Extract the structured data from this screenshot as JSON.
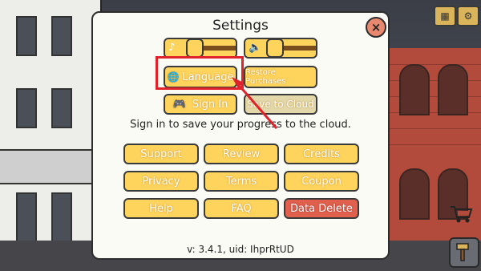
{
  "dialog": {
    "title": "Settings",
    "buttons": {
      "language": "Language",
      "restore_purchases": "Restore Purchases",
      "sign_in": "Sign In",
      "save_to_cloud": "Save to Cloud"
    },
    "info": "Sign in to save your progress to the cloud.",
    "grid": [
      "Support",
      "Review",
      "Credits",
      "Privacy",
      "Terms",
      "Coupon",
      "Help",
      "FAQ",
      "Data Delete"
    ],
    "version": "v: 3.4.1, uid: IhprRtUD"
  },
  "colors": {
    "button": "#ffd45c",
    "danger": "#e0604d",
    "highlight": "#e0222a"
  },
  "icons": {
    "close": "×",
    "globe": "🌐",
    "gamepad": "🎮",
    "music_muted": "♪",
    "sound_muted": "🔈"
  }
}
